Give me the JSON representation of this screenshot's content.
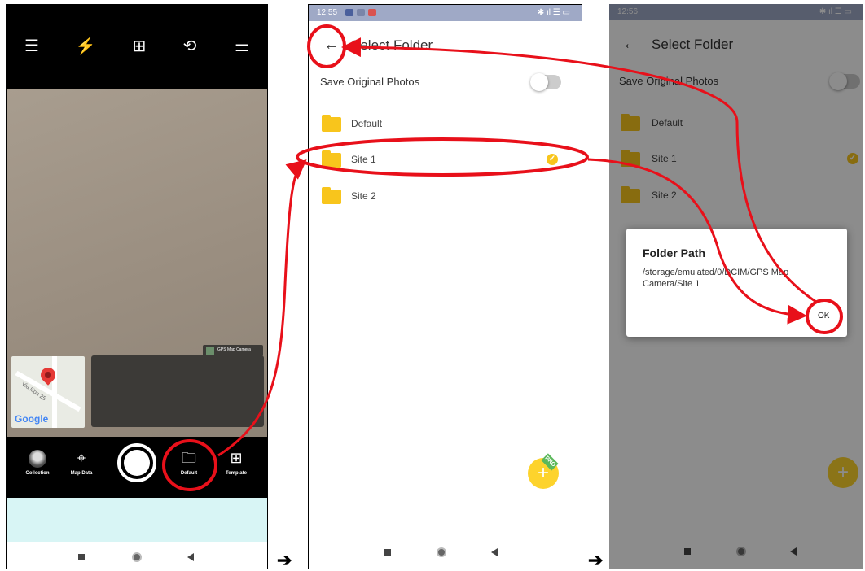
{
  "camera": {
    "map_street": "Via Ilion 25",
    "map_logo": "Google",
    "gps_badge": "GPS Map Camera",
    "bottom": {
      "collection": "Collection",
      "map_data": "Map Data",
      "default": "Default",
      "template": "Template"
    }
  },
  "select_folder": {
    "time": "12:55",
    "title": "Select Folder",
    "save_original": "Save Original Photos",
    "folders": [
      "Default",
      "Site 1",
      "Site 2"
    ],
    "selected_index": 1,
    "fab_badge": "PRO"
  },
  "dialog_screen": {
    "time": "12:56",
    "title": "Select Folder",
    "save_original": "Save Original Photos",
    "folders": [
      "Default",
      "Site 1",
      "Site 2"
    ],
    "dialog": {
      "title": "Folder Path",
      "path": "/storage/emulated/0/DCIM/GPS Map Camera/Site 1",
      "ok": "OK"
    }
  },
  "colors": {
    "annotation_red": "#e8101a",
    "folder_yellow": "#f8c51c",
    "status_bar": "#9fa9c6"
  }
}
